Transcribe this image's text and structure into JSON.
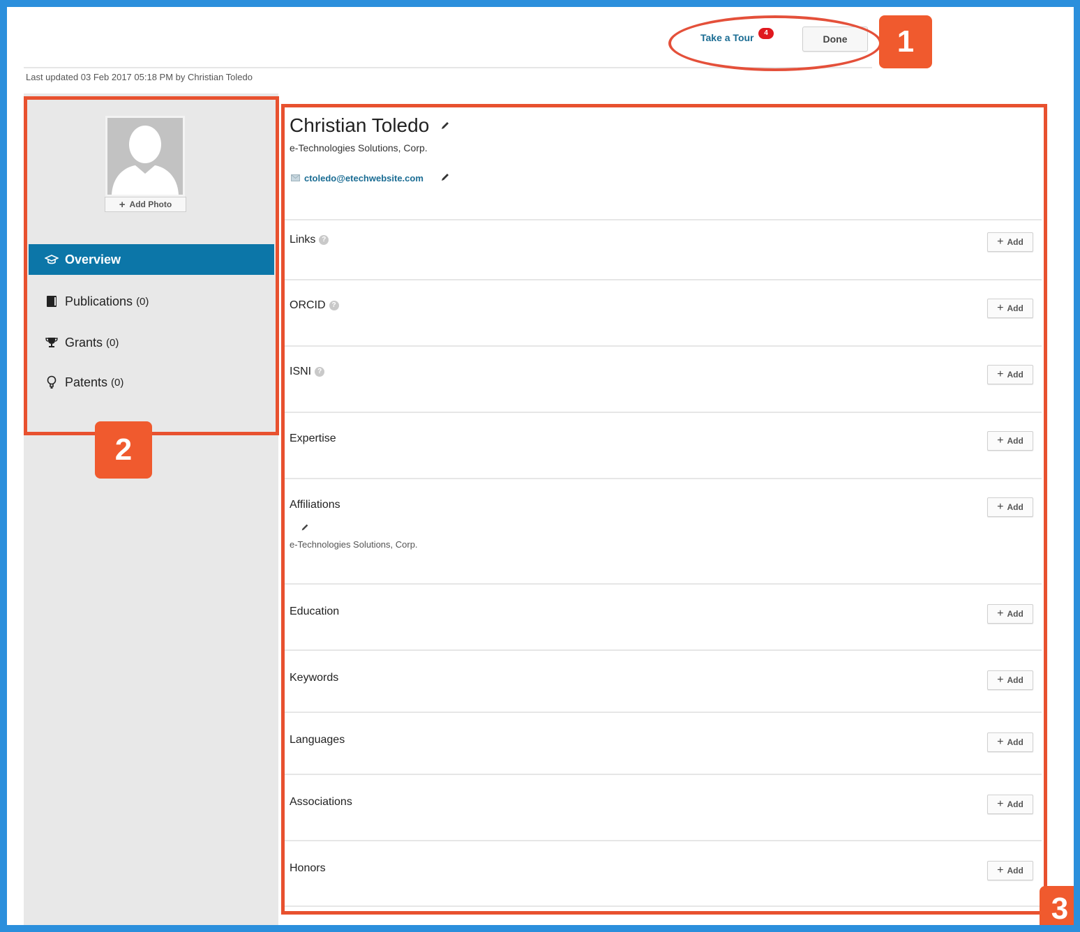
{
  "header": {
    "tour_label": "Take a Tour",
    "tour_badge": "4",
    "done_label": "Done"
  },
  "last_updated": "Last updated 03 Feb 2017 05:18 PM by Christian Toledo",
  "sidebar": {
    "add_photo_label": "Add Photo",
    "items": [
      {
        "label": "Overview",
        "count": "",
        "icon": "graduation-cap-icon",
        "active": true
      },
      {
        "label": "Publications",
        "count": "(0)",
        "icon": "book-icon",
        "active": false
      },
      {
        "label": "Grants",
        "count": "(0)",
        "icon": "trophy-icon",
        "active": false
      },
      {
        "label": "Patents",
        "count": "(0)",
        "icon": "lightbulb-icon",
        "active": false
      }
    ]
  },
  "profile": {
    "name": "Christian Toledo",
    "organization": "e-Technologies Solutions, Corp.",
    "email": "ctoledo@etechwebsite.com"
  },
  "sections": {
    "add_label": "Add",
    "links": "Links",
    "orcid": "ORCID",
    "isni": "ISNI",
    "expertise": "Expertise",
    "affiliations": "Affiliations",
    "affiliation_org": "e-Technologies Solutions, Corp.",
    "education": "Education",
    "keywords": "Keywords",
    "languages": "Languages",
    "associations": "Associations",
    "honors": "Honors"
  },
  "callouts": {
    "one": "1",
    "two": "2",
    "three": "3"
  },
  "colors": {
    "accent": "#0c76a8",
    "link": "#1a6c93",
    "annotation": "#e8512f",
    "frame": "#2b8fdc",
    "badge": "#e0181e"
  }
}
